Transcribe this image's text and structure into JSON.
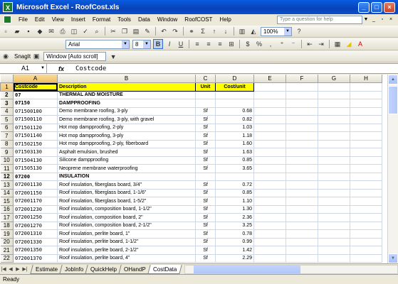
{
  "window": {
    "title": "Microsoft Excel - RoofCost.xls",
    "app_icon": "X"
  },
  "menu": [
    "File",
    "Edit",
    "View",
    "Insert",
    "Format",
    "Tools",
    "Data",
    "Window",
    "RoofCOST",
    "Help"
  ],
  "help_placeholder": "Type a question for help",
  "toolbar": {
    "zoom": "100%",
    "font": "Arial",
    "font_size": "8",
    "bold": "B",
    "italic": "I",
    "underline": "U",
    "currency": "$",
    "percent": "%",
    "comma": ",",
    "sigma": "Σ",
    "fx_label": "fx"
  },
  "snagit": {
    "label": "SnagIt",
    "window_combo": "Window [Auto scroll]"
  },
  "formula_bar": {
    "cell": "A1",
    "content": "Costcode"
  },
  "columns": [
    "A",
    "B",
    "C",
    "D",
    "E",
    "F",
    "G",
    "H"
  ],
  "header_row": {
    "code": "Costcode",
    "desc": "Description",
    "unit": "Unit",
    "cost": "Cost/unit"
  },
  "rows": [
    {
      "n": "2",
      "code": "07",
      "desc": "THERMAL AND MOISTURE",
      "unit": "",
      "cost": "",
      "section": true
    },
    {
      "n": "3",
      "code": "07150",
      "desc": "DAMPPROOFING",
      "unit": "",
      "cost": "",
      "section": true
    },
    {
      "n": "4",
      "code": "071500100",
      "desc": "Demo membrane roofing, 3-ply",
      "unit": "Sf",
      "cost": "0.68"
    },
    {
      "n": "5",
      "code": "071500110",
      "desc": "Demo membrane roofing, 3-ply, with gravel",
      "unit": "Sf",
      "cost": "0.82"
    },
    {
      "n": "6",
      "code": "071501120",
      "desc": "Hot mop dampproofing, 2-ply",
      "unit": "Sf",
      "cost": "1.03"
    },
    {
      "n": "7",
      "code": "071501140",
      "desc": "Hot mop dampproofing, 3-ply",
      "unit": "Sf",
      "cost": "1.18"
    },
    {
      "n": "8",
      "code": "071502150",
      "desc": "Hot mop dampproofing, 2-ply, fiberboard",
      "unit": "Sf",
      "cost": "1.60"
    },
    {
      "n": "9",
      "code": "071503130",
      "desc": "Asphalt emulsion, brushed",
      "unit": "Sf",
      "cost": "1.63"
    },
    {
      "n": "10",
      "code": "071504130",
      "desc": "Silicone dampproofing",
      "unit": "Sf",
      "cost": "0.85"
    },
    {
      "n": "11",
      "code": "071505130",
      "desc": "Neoprene membrane waterproofing",
      "unit": "Sf",
      "cost": "3.65"
    },
    {
      "n": "12",
      "code": "07200",
      "desc": "INSULATION",
      "unit": "",
      "cost": "",
      "section": true
    },
    {
      "n": "13",
      "code": "072001130",
      "desc": "Roof insulation, fiberglass board, 3/4\"",
      "unit": "Sf",
      "cost": "0.72"
    },
    {
      "n": "14",
      "code": "072001150",
      "desc": "Roof insulation, fiberglass board, 1-1/6\"",
      "unit": "Sf",
      "cost": "0.85"
    },
    {
      "n": "15",
      "code": "072001170",
      "desc": "Roof insulation, fiberglass board, 1-5/2\"",
      "unit": "Sf",
      "cost": "1.10"
    },
    {
      "n": "16",
      "code": "072001230",
      "desc": "Roof insulation, composition board, 1-1/2\"",
      "unit": "Sf",
      "cost": "1.30"
    },
    {
      "n": "17",
      "code": "072001250",
      "desc": "Roof insulation, composition board, 2\"",
      "unit": "Sf",
      "cost": "2.36"
    },
    {
      "n": "18",
      "code": "072001270",
      "desc": "Roof insulation, composition board, 2-1/2\"",
      "unit": "Sf",
      "cost": "3.25"
    },
    {
      "n": "19",
      "code": "072001310",
      "desc": "Roof insulation, perlite board, 1\"",
      "unit": "Sf",
      "cost": "0.78"
    },
    {
      "n": "20",
      "code": "072001330",
      "desc": "Roof insulation, perlite board, 1-1/2\"",
      "unit": "Sf",
      "cost": "0.99"
    },
    {
      "n": "21",
      "code": "072001350",
      "desc": "Roof insulation, perlite board, 2-1/2\"",
      "unit": "Sf",
      "cost": "1.42"
    },
    {
      "n": "22",
      "code": "072001370",
      "desc": "Roof insulation, perlite board, 4\"",
      "unit": "Sf",
      "cost": "2.29"
    }
  ],
  "sheet_tabs": [
    "Estimate",
    "JobInfo",
    "QuickHelp",
    "OHandP",
    "CostData"
  ],
  "active_tab": "CostData",
  "status": "Ready"
}
